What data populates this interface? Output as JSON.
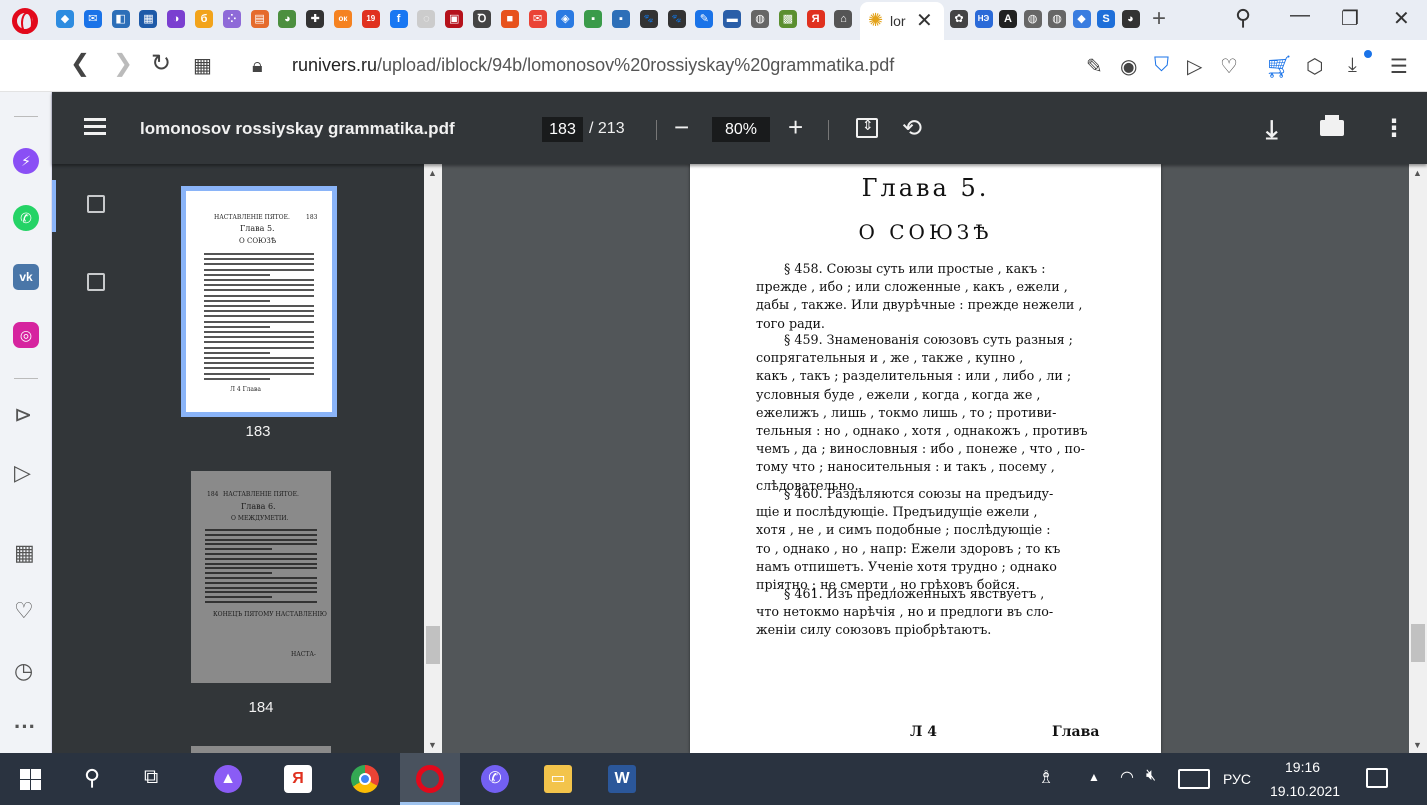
{
  "browser": {
    "active_tab_title": "lor",
    "url_host": "runivers.ru",
    "url_path": "/upload/iblock/94b/lomonosov%20rossiyskay%20grammatika.pdf",
    "tab_icons": [
      {
        "name": "tab-icon-1",
        "color": "#2d8ce0",
        "glyph": "◆"
      },
      {
        "name": "tab-icon-mail",
        "color": "#1a73e8",
        "glyph": "✉"
      },
      {
        "name": "tab-icon-3",
        "color": "#2d6fb8",
        "glyph": "◧"
      },
      {
        "name": "tab-icon-4",
        "color": "#1e5aa8",
        "glyph": "▦"
      },
      {
        "name": "tab-icon-5",
        "color": "#7a3fd0",
        "glyph": "◑"
      },
      {
        "name": "tab-icon-6",
        "color": "#f2a31b",
        "glyph": "б"
      },
      {
        "name": "tab-icon-7",
        "color": "#8e6ad8",
        "glyph": "⁘"
      },
      {
        "name": "tab-icon-8",
        "color": "#e56b2c",
        "glyph": "▤"
      },
      {
        "name": "tab-icon-9",
        "color": "#4c8f3f",
        "glyph": "◕"
      },
      {
        "name": "tab-icon-10",
        "color": "#333333",
        "glyph": "✚"
      },
      {
        "name": "tab-icon-ok",
        "color": "#f58220",
        "glyph": "ок"
      },
      {
        "name": "tab-icon-19",
        "color": "#e0311f",
        "glyph": "19"
      },
      {
        "name": "tab-icon-facebook",
        "color": "#1877f2",
        "glyph": "f"
      },
      {
        "name": "tab-icon-14",
        "color": "#cccccc",
        "glyph": "◌"
      },
      {
        "name": "tab-icon-15",
        "color": "#b5121b",
        "glyph": "▣"
      },
      {
        "name": "tab-icon-16",
        "color": "#444444",
        "glyph": "Ꝺ"
      },
      {
        "name": "tab-icon-17",
        "color": "#e7521c",
        "glyph": "■"
      },
      {
        "name": "tab-icon-gmail",
        "color": "#ea4335",
        "glyph": "✉"
      },
      {
        "name": "tab-icon-19b",
        "color": "#2a7ae2",
        "glyph": "◈"
      },
      {
        "name": "tab-icon-20",
        "color": "#3a9b4a",
        "glyph": "▪"
      },
      {
        "name": "tab-icon-21",
        "color": "#2d6fb8",
        "glyph": "▪"
      },
      {
        "name": "tab-icon-paw-1",
        "color": "#333333",
        "glyph": "🐾"
      },
      {
        "name": "tab-icon-paw-2",
        "color": "#333333",
        "glyph": "🐾"
      },
      {
        "name": "tab-icon-chat",
        "color": "#1a73e8",
        "glyph": "✎"
      },
      {
        "name": "tab-icon-25",
        "color": "#2a5ea8",
        "glyph": "▬"
      },
      {
        "name": "tab-icon-26",
        "color": "#666666",
        "glyph": "◍"
      },
      {
        "name": "tab-icon-27",
        "color": "#5b8f2f",
        "glyph": "▩"
      },
      {
        "name": "tab-icon-yandex",
        "color": "#e0311f",
        "glyph": "Я"
      },
      {
        "name": "tab-icon-29",
        "color": "#555555",
        "glyph": "⌂"
      }
    ],
    "tab_icons_after": [
      {
        "name": "tab-icon-31",
        "color": "#444444",
        "glyph": "✿"
      },
      {
        "name": "tab-icon-neb",
        "color": "#2a6ad8",
        "glyph": "НЭ"
      },
      {
        "name": "tab-icon-33",
        "color": "#222222",
        "glyph": "A"
      },
      {
        "name": "tab-icon-34",
        "color": "#666666",
        "glyph": "◍"
      },
      {
        "name": "tab-icon-35",
        "color": "#666666",
        "glyph": "◍"
      },
      {
        "name": "tab-icon-36",
        "color": "#3a7de0",
        "glyph": "◆"
      },
      {
        "name": "tab-icon-37",
        "color": "#1e6fd9",
        "glyph": "S"
      },
      {
        "name": "tab-icon-38",
        "color": "#333333",
        "glyph": "◕"
      }
    ]
  },
  "pdf": {
    "file_name": "lomonosov rossiyskay grammatika.pdf",
    "current_page": "183",
    "page_total": "/ 213",
    "zoom": "80%",
    "thumb_labels": [
      "183",
      "184"
    ],
    "thumb_183": {
      "header": "НАСТАВЛЕНІЕ ПЯТОЕ.",
      "num": "183",
      "chapter": "Глава 5.",
      "section": "О СОЮЗѢ",
      "foot": "Л 4          Глава"
    },
    "thumb_184": {
      "num": "184",
      "header": "НАСТАВЛЕНІЕ ПЯТОЕ.",
      "chapter": "Глава 6.",
      "section": "О МЕЖДУМЕТІИ.",
      "end": "КОНЕЦЪ ПЯТОМУ НАСТАВЛЕНІЮ",
      "foot": "НАСТА-"
    }
  },
  "page_text": {
    "chapter": "Глава 5.",
    "section": "О СОЮЗѢ",
    "p458": [
      "§ 458. Союзы суть или простые , какъ :",
      "прежде , ибо ; или сложенные , какъ , ежели ,",
      "дабы , также. Или двурѣчные : прежде нежели ,",
      "того ради."
    ],
    "p459": [
      "§ 459. Знаменованія союзовъ суть разныя ;",
      "сопрягательныя  и , же , также , купно ,",
      "какъ , такъ ; разделительныя : или , либо , ли ;",
      "условныя  буде , ежели , когда , когда же ,",
      "ежелижъ , лишь , токмо лишь , то ; противи-",
      "тельныя : но , однако , хотя , однакожъ , противъ",
      "чемъ , да ; винословныя : ибо , понеже , что , по-",
      "тому что ; наносительныя : и такъ , посему ,",
      "слѣдовательно."
    ],
    "p460": [
      "§ 460. Раздѣляются союзы на предъиду-",
      "щіе и послѣдующіе. Предъидущіе  ежели ,",
      "хотя , не , и симъ подобные ; послѣдующіе :",
      "то , однако , но , напр: Ежели здоровъ ; то къ",
      "намъ отпишетъ. Ученіе хотя трудно ; однако",
      "пріятно ; не смерти , но грѣховъ бойся."
    ],
    "p461": [
      "§ 461. Изъ предложенныхъ явствуетъ ,",
      "что нетокмо нарѣчія , но и предлоги въ сло-",
      "женіи силу союзовъ пріобрѣтаютъ."
    ],
    "signature": "Л 4",
    "catchword": "Глава"
  },
  "taskbar": {
    "language": "РУС",
    "time": "19:16",
    "date": "19.10.2021"
  }
}
